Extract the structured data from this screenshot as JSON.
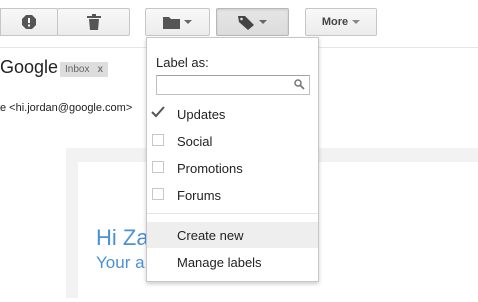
{
  "toolbar": {
    "buttons": [
      {
        "icon": "report-spam-icon"
      },
      {
        "icon": "trash-icon"
      },
      {
        "icon": "folder-move-icon"
      },
      {
        "icon": "label-tag-icon"
      }
    ],
    "more_label": "More"
  },
  "email": {
    "subject_fragment": "Google",
    "label_chip": "Inbox",
    "label_chip_remove": "x",
    "sender_fragment": "e <hi.jordan@google.com>",
    "greeting_fragment": "Hi Za",
    "subline_fragment": "Your a"
  },
  "label_menu": {
    "title": "Label as:",
    "search_placeholder": "",
    "labels": [
      {
        "name": "Updates",
        "checked": true
      },
      {
        "name": "Social",
        "checked": false
      },
      {
        "name": "Promotions",
        "checked": false
      },
      {
        "name": "Forums",
        "checked": false
      }
    ],
    "actions": [
      {
        "label": "Create new",
        "highlighted": true
      },
      {
        "label": "Manage labels",
        "highlighted": false
      }
    ]
  },
  "colors": {
    "accent_blue": "#4a90d9",
    "menu_hover": "#eeeeee"
  }
}
